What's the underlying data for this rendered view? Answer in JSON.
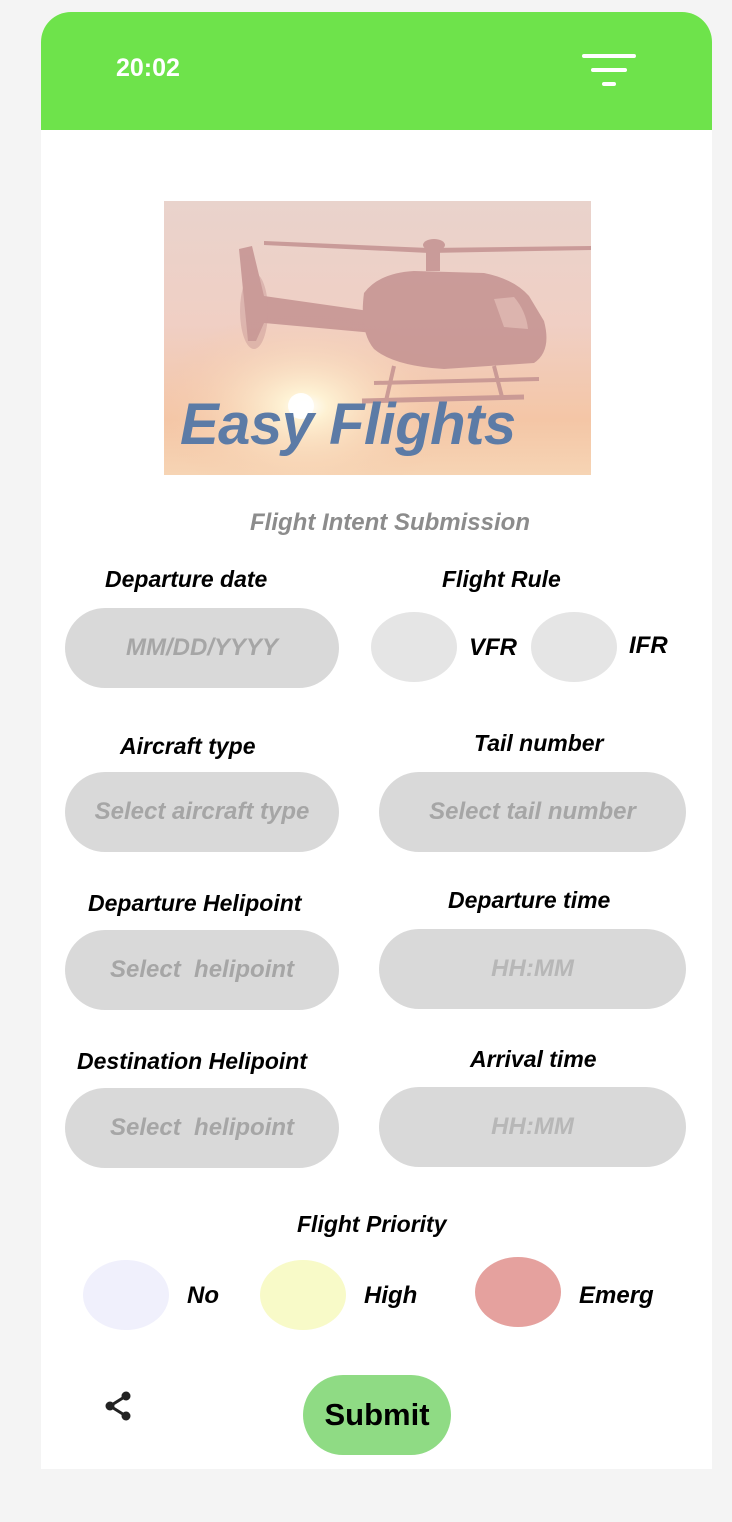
{
  "status_bar": {
    "time": "20:02",
    "filter_icon": "filter-icon"
  },
  "hero": {
    "title": "Easy Flights",
    "image": "helicopter-sunset-image"
  },
  "form": {
    "heading": "Flight Intent Submission",
    "departure_date": {
      "label": "Departure date",
      "placeholder": "MM/DD/YYYY"
    },
    "flight_rule": {
      "label": "Flight Rule",
      "options": [
        {
          "label": "VFR",
          "color": "#e5e5e5"
        },
        {
          "label": "IFR",
          "color": "#e5e5e5"
        }
      ]
    },
    "aircraft_type": {
      "label": "Aircraft type",
      "placeholder": "Select aircraft type"
    },
    "tail_number": {
      "label": "Tail number",
      "placeholder": "Select tail number"
    },
    "departure_helipoint": {
      "label": "Departure Helipoint",
      "placeholder": "Select  helipoint"
    },
    "departure_time": {
      "label": "Departure time",
      "placeholder": "HH:MM"
    },
    "destination_helipoint": {
      "label": "Destination Helipoint",
      "placeholder": "Select  helipoint"
    },
    "arrival_time": {
      "label": "Arrival time",
      "placeholder": "HH:MM"
    },
    "flight_priority": {
      "label": "Flight Priority",
      "options": [
        {
          "label": "No",
          "color": "#f0f0fc"
        },
        {
          "label": "High",
          "color": "#f8fac8"
        },
        {
          "label": "Emerg",
          "color": "#e5a19e"
        }
      ]
    }
  },
  "footer": {
    "share_icon": "share-icon",
    "submit_label": "Submit"
  },
  "colors": {
    "accent": "#6ee34b",
    "submit": "#8fdb84",
    "field": "#d9d9d9"
  }
}
